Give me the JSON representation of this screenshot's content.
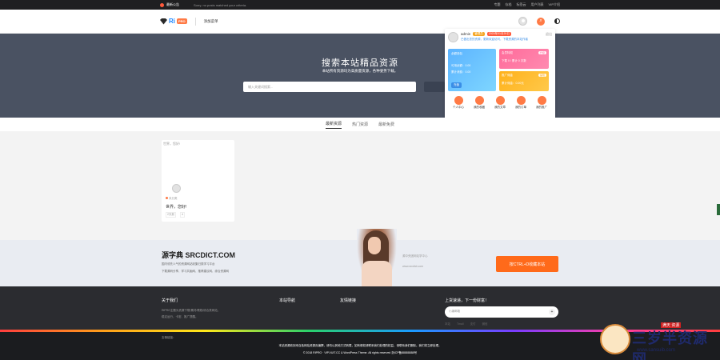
{
  "topbar": {
    "notice_label": "最新公告",
    "notice_message": "Sorry, no posts matched your criteria.",
    "links": [
      "专题",
      "存档",
      "标签云",
      "用户列表",
      "VIP介绍"
    ]
  },
  "header": {
    "logo_text": "Ri",
    "logo_badge": "PRO",
    "nav_item": "添加菜单"
  },
  "hero": {
    "title": "搜索本站精品资源",
    "subtitle": "本站所有资源均为高质量资源，各种姿势下载。",
    "search_placeholder": "输入关键词搜索..."
  },
  "dropdown": {
    "username": "admin",
    "role_tag": "管理员",
    "vip_tag": "2020年01月20日",
    "logout": "退出",
    "desc": "已做出您的资源，更新欢迎访问，下载资源的本站作者",
    "card_a": {
      "title": "余额钱包",
      "line1": "可用余额：0.00",
      "line2": "累计消费：0.00",
      "btn": "充值"
    },
    "card_b1": {
      "title": "会员特权",
      "pill": "升级",
      "line": "下载 0 / 累计 0 次数"
    },
    "card_b2": {
      "title": "推广佣金",
      "pill": "提现",
      "line": "累计佣金：0.00元"
    },
    "icons": [
      "个人中心",
      "我的收藏",
      "我的文章",
      "我的订单",
      "我的推广"
    ]
  },
  "tabs": [
    "最新资源",
    "热门资源",
    "最新免费"
  ],
  "post": {
    "thumb_alt": "世界，您好!",
    "category": "未分类",
    "title": "世界，您好!",
    "date": "2天前",
    "views": "4"
  },
  "promo": {
    "title": "源字典 SRCDICT.COM",
    "desc1": "国内领先人气的资源网站收集归类学习平台",
    "desc2": "下载源码分享、学习共勉网、推荐建议网、综合资源网",
    "right1": "源中央团网站学中心",
    "right2": "www.srcdict.com",
    "cta": "按CTRL+D收藏本站"
  },
  "footer": {
    "col_about": "关于我们",
    "about_text_1": "RiPRO主题为资源下载/素材/教程/综合类网站，",
    "about_text_2": "稳定运行，卡密、推广提醒。",
    "col_nav": "本站导航",
    "col_links": "友情链接",
    "col_subscribe": "上货速递，下一份财富！",
    "subscribe_placeholder": "小编邮箱",
    "friend_links_label": "友情链接：",
    "copyright_1": "本站资源收到来自各网站资源页编撰，请勿以其他方式转载，如有侵权请联系我们处理的权益，请联系我们删除。我们将立即处理。",
    "copyright_2": "© 2018 RIPRO · VIP.VUIT.CC & WordPress Theme. All rights reserved 浙ICP备88888888号",
    "badges": [
      "本站",
      "Tmall",
      "支付",
      "微信"
    ]
  },
  "watermark": {
    "text": "三岁半资源网",
    "url": "www.sansuib.com",
    "tag": "满天 资源"
  }
}
